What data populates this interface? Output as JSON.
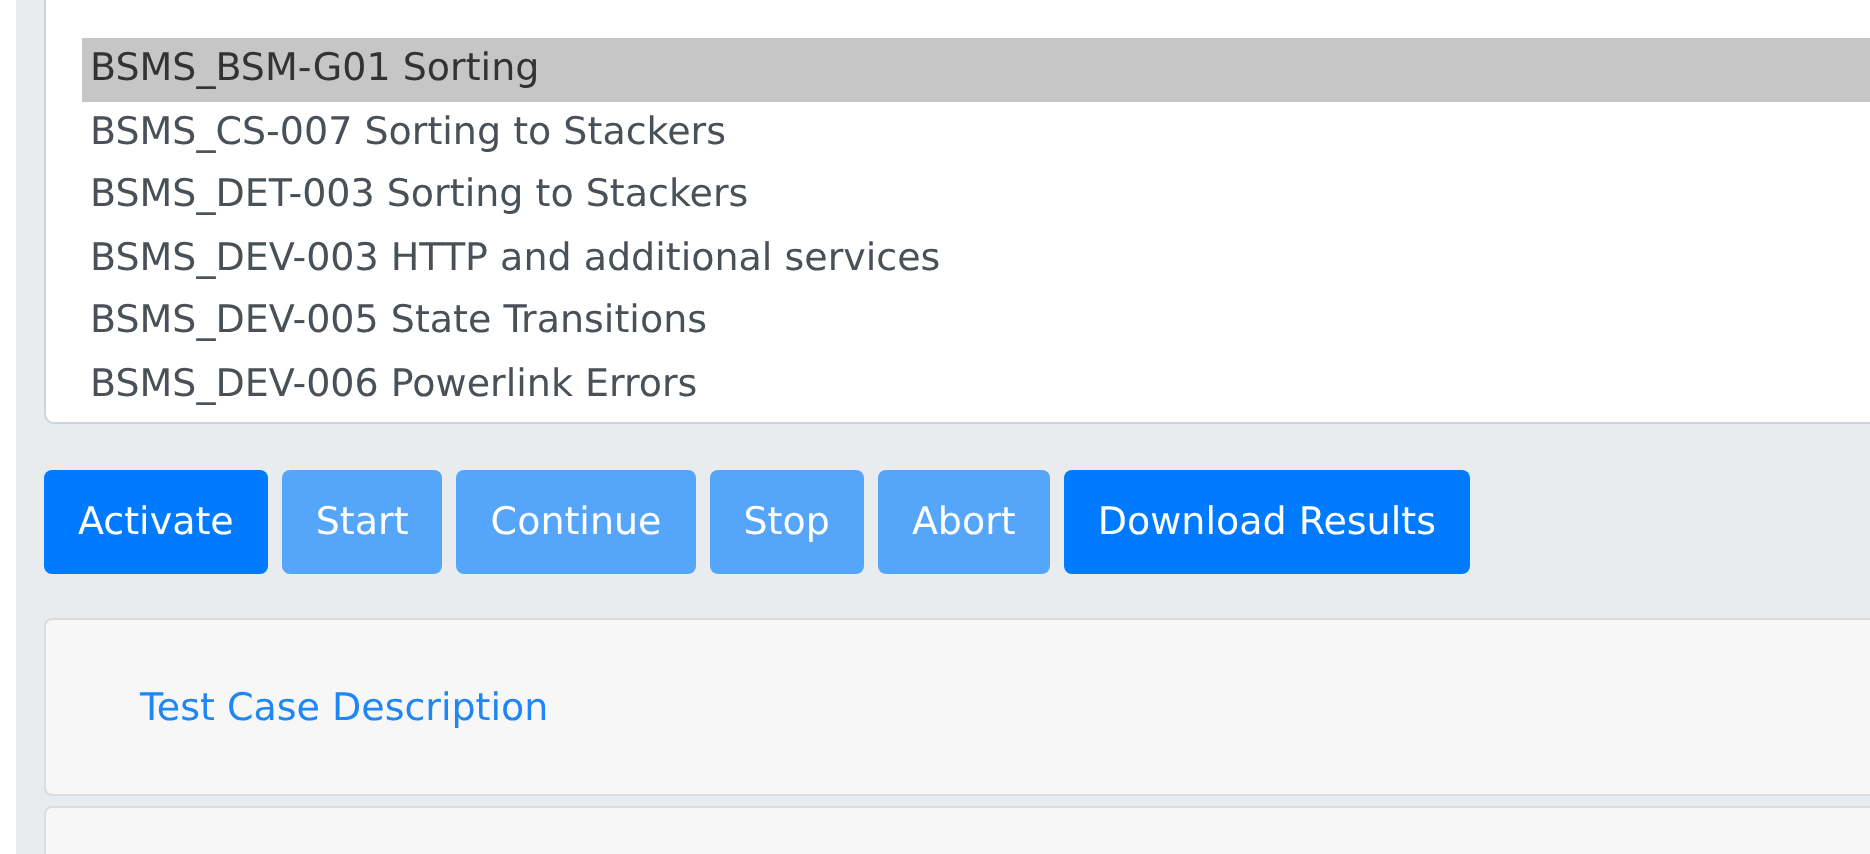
{
  "test_list": {
    "items": [
      {
        "label": "BSMS_BSM-G01 Sorting",
        "selected": true
      },
      {
        "label": "BSMS_CS-007 Sorting to Stackers",
        "selected": false
      },
      {
        "label": "BSMS_DET-003 Sorting to Stackers",
        "selected": false
      },
      {
        "label": "BSMS_DEV-003 HTTP and additional services",
        "selected": false
      },
      {
        "label": "BSMS_DEV-005 State Transitions",
        "selected": false
      },
      {
        "label": "BSMS_DEV-006 Powerlink Errors",
        "selected": false
      }
    ]
  },
  "buttons": [
    {
      "label": "Activate",
      "disabled": false
    },
    {
      "label": "Start",
      "disabled": true
    },
    {
      "label": "Continue",
      "disabled": true
    },
    {
      "label": "Stop",
      "disabled": true
    },
    {
      "label": "Abort",
      "disabled": true
    },
    {
      "label": "Download Results",
      "disabled": false
    }
  ],
  "cards": [
    {
      "link": "Test Case Description"
    }
  ]
}
